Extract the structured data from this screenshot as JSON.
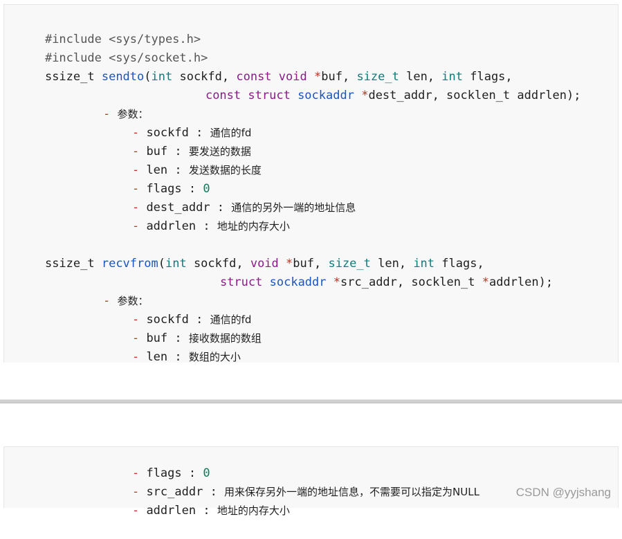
{
  "block1": {
    "include1": "#include <sys/types.h>",
    "include2": "#include <sys/socket.h>",
    "sendto": {
      "ret": "ssize_t ",
      "name": "sendto",
      "open": "(",
      "int1": "int",
      "p1": " sockfd, ",
      "const1": "const",
      "sp1": " ",
      "void1": "void",
      "sp2": " ",
      "star1": "*",
      "p2": "buf, ",
      "sizet": "size_t",
      "p3": " len, ",
      "int2": "int",
      "p4": " flags,",
      "const2": "const",
      "sp3": " ",
      "struct1": "struct",
      "sp4": " ",
      "sockaddr": "sockaddr",
      "sp5": " ",
      "star2": "*",
      "p5": "dest_addr, socklen_t addrlen);"
    },
    "params_label": "参数：",
    "sendto_params": [
      {
        "name": "sockfd",
        "sep": " : ",
        "desc": "通信的fd",
        "is_num": false
      },
      {
        "name": "buf",
        "sep": " : ",
        "desc": "要发送的数据",
        "is_num": false
      },
      {
        "name": "len",
        "sep": " : ",
        "desc": "发送数据的长度",
        "is_num": false
      },
      {
        "name": "flags",
        "sep": " : ",
        "desc": "0",
        "is_num": true
      },
      {
        "name": "dest_addr",
        "sep": " : ",
        "desc": "通信的另外一端的地址信息",
        "is_num": false
      },
      {
        "name": "addrlen",
        "sep": " : ",
        "desc": "地址的内存大小",
        "is_num": false
      }
    ],
    "recvfrom": {
      "ret": "ssize_t ",
      "name": "recvfrom",
      "open": "(",
      "int1": "int",
      "p1": " sockfd, ",
      "void1": "void",
      "sp1": " ",
      "star1": "*",
      "p2": "buf, ",
      "sizet": "size_t",
      "p3": " len, ",
      "int2": "int",
      "p4": " flags,",
      "struct1": "struct",
      "sp2": " ",
      "sockaddr": "sockaddr",
      "sp3": " ",
      "star2": "*",
      "p5": "src_addr, socklen_t ",
      "star3": "*",
      "p6": "addrlen);"
    },
    "recvfrom_params": [
      {
        "name": "sockfd",
        "sep": " : ",
        "desc": "通信的fd",
        "is_num": false
      },
      {
        "name": "buf",
        "sep": " : ",
        "desc": "接收数据的数组",
        "is_num": false
      },
      {
        "name": "len",
        "sep": " : ",
        "desc": "数组的大小",
        "is_num": false
      }
    ]
  },
  "block2": {
    "params": [
      {
        "name": "flags",
        "sep": " : ",
        "desc": "0",
        "is_num": true
      },
      {
        "name": "src_addr",
        "sep": " : ",
        "desc": "用来保存另外一端的地址信息，不需要可以指定为NULL",
        "is_num": false
      },
      {
        "name": "addrlen",
        "sep": " : ",
        "desc": "地址的内存大小",
        "is_num": false
      }
    ]
  },
  "bullet_char": "- ",
  "watermark": "CSDN @yyjshang"
}
